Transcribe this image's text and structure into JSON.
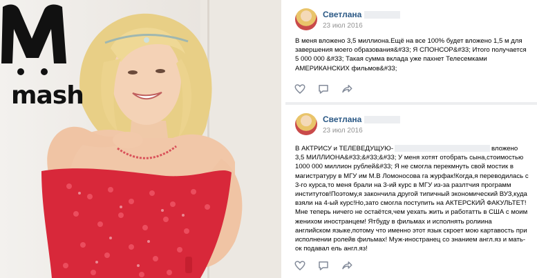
{
  "logo": {
    "text": "mash"
  },
  "posts": [
    {
      "author": "Светлана",
      "date": "23 июл 2016",
      "text": "В меня вложено 3,5 миллиона.Ещё на все 100% будет вложено 1,5 м для завершения моего образования&#33; Я СПОНСОР&#33; Итого получается 5 000 000 &#33; Такая сумма вклада уже пахнет Телесемками АМЕРИКАНСКИХ фильмов&#33;"
    },
    {
      "author": "Светлана",
      "date": "23 июл 2016",
      "text_before": "В АКТРИСУ и ТЕЛЕВЕДУЩУЮ-",
      "text_after": "вложено 3,5 МИЛЛИОНА&#33;&#33;&#33; У меня хотят отобрать сына,стоимостью 1000 000 миллион рублей&#33; Я не смогла перекмнуть свой мостик в магистратуру в МГУ им М.В Ломоносова га журфак!Когда,я переводилась с 3-го курса,то меня брали на 3-ий курс в МГУ из-за разлтчия программ институтов!Поэтому,я закончила другой типичный экономический ВУЗ,куда взяли на 4-ый курс!Но,зато смогла поступить на АКТЕРСКИЙ ФАКУЛЬТЕТ! Мне теперь ничего не остаётся,чем уехать жить и работатть в США с моим женихом иностранцем! Ятбуду в фильмах и исполнять ролиина английском языке,потому что именно этот язык скроет мою картавость при исполнении ролейв фильмах! Муж-иностранец со знанием англ.яз и мать-ок подавал ель англ.яз!"
    }
  ],
  "icons": {
    "like": "heart-icon",
    "comment": "comment-icon",
    "share": "share-icon"
  },
  "colors": {
    "author": "#2a5885",
    "date": "#939393",
    "dress": "#d8283a",
    "feed_gap": "#edeef0"
  }
}
